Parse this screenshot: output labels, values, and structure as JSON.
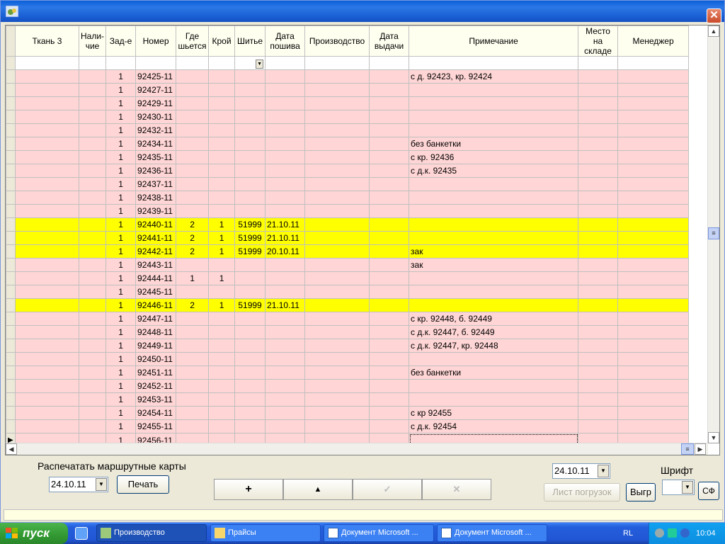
{
  "window": {
    "title": ""
  },
  "grid": {
    "columns": [
      "Ткань 3",
      "Нали-чие",
      "Зад-е",
      "Номер",
      "Где шьется",
      "Крой",
      "Шитье",
      "Дата пошива",
      "Производство",
      "Дата выдачи",
      "Примечание",
      "Место на складе",
      "Менеджер"
    ],
    "rows": [
      {
        "zad": "1",
        "nomer": "92425-11",
        "gde": "",
        "kroy": "",
        "shitye": "",
        "data": "",
        "prim": "с д. 92423, кр. 92424",
        "color": "pink"
      },
      {
        "zad": "1",
        "nomer": "92427-11",
        "gde": "",
        "kroy": "",
        "shitye": "",
        "data": "",
        "prim": "",
        "color": "pink"
      },
      {
        "zad": "1",
        "nomer": "92429-11",
        "gde": "",
        "kroy": "",
        "shitye": "",
        "data": "",
        "prim": "",
        "color": "pink"
      },
      {
        "zad": "1",
        "nomer": "92430-11",
        "gde": "",
        "kroy": "",
        "shitye": "",
        "data": "",
        "prim": "",
        "color": "pink"
      },
      {
        "zad": "1",
        "nomer": "92432-11",
        "gde": "",
        "kroy": "",
        "shitye": "",
        "data": "",
        "prim": "",
        "color": "pink"
      },
      {
        "zad": "1",
        "nomer": "92434-11",
        "gde": "",
        "kroy": "",
        "shitye": "",
        "data": "",
        "prim": "без банкетки",
        "color": "pink"
      },
      {
        "zad": "1",
        "nomer": "92435-11",
        "gde": "",
        "kroy": "",
        "shitye": "",
        "data": "",
        "prim": "с кр. 92436",
        "color": "pink"
      },
      {
        "zad": "1",
        "nomer": "92436-11",
        "gde": "",
        "kroy": "",
        "shitye": "",
        "data": "",
        "prim": "с д.к. 92435",
        "color": "pink"
      },
      {
        "zad": "1",
        "nomer": "92437-11",
        "gde": "",
        "kroy": "",
        "shitye": "",
        "data": "",
        "prim": "",
        "color": "pink"
      },
      {
        "zad": "1",
        "nomer": "92438-11",
        "gde": "",
        "kroy": "",
        "shitye": "",
        "data": "",
        "prim": "",
        "color": "pink"
      },
      {
        "zad": "1",
        "nomer": "92439-11",
        "gde": "",
        "kroy": "",
        "shitye": "",
        "data": "",
        "prim": "",
        "color": "pink"
      },
      {
        "zad": "1",
        "nomer": "92440-11",
        "gde": "2",
        "kroy": "1",
        "shitye": "51999",
        "data": "21.10.11",
        "prim": "",
        "color": "yellow"
      },
      {
        "zad": "1",
        "nomer": "92441-11",
        "gde": "2",
        "kroy": "1",
        "shitye": "51999",
        "data": "21.10.11",
        "prim": "",
        "color": "yellow"
      },
      {
        "zad": "1",
        "nomer": "92442-11",
        "gde": "2",
        "kroy": "1",
        "shitye": "51999",
        "data": "20.10.11",
        "prim": "зак",
        "color": "yellow"
      },
      {
        "zad": "1",
        "nomer": "92443-11",
        "gde": "",
        "kroy": "",
        "shitye": "",
        "data": "",
        "prim": "зак",
        "color": "pink"
      },
      {
        "zad": "1",
        "nomer": "92444-11",
        "gde": "1",
        "kroy": "1",
        "shitye": "",
        "data": "",
        "prim": "",
        "color": "pink"
      },
      {
        "zad": "1",
        "nomer": "92445-11",
        "gde": "",
        "kroy": "",
        "shitye": "",
        "data": "",
        "prim": "",
        "color": "pink"
      },
      {
        "zad": "1",
        "nomer": "92446-11",
        "gde": "2",
        "kroy": "1",
        "shitye": "51999",
        "data": "21.10.11",
        "prim": "",
        "color": "yellow"
      },
      {
        "zad": "1",
        "nomer": "92447-11",
        "gde": "",
        "kroy": "",
        "shitye": "",
        "data": "",
        "prim": "с кр. 92448, б. 92449",
        "color": "pink"
      },
      {
        "zad": "1",
        "nomer": "92448-11",
        "gde": "",
        "kroy": "",
        "shitye": "",
        "data": "",
        "prim": "с д.к. 92447, б. 92449",
        "color": "pink"
      },
      {
        "zad": "1",
        "nomer": "92449-11",
        "gde": "",
        "kroy": "",
        "shitye": "",
        "data": "",
        "prim": "с д.к. 92447, кр. 92448",
        "color": "pink"
      },
      {
        "zad": "1",
        "nomer": "92450-11",
        "gde": "",
        "kroy": "",
        "shitye": "",
        "data": "",
        "prim": "",
        "color": "pink"
      },
      {
        "zad": "1",
        "nomer": "92451-11",
        "gde": "",
        "kroy": "",
        "shitye": "",
        "data": "",
        "prim": "без банкетки",
        "color": "pink"
      },
      {
        "zad": "1",
        "nomer": "92452-11",
        "gde": "",
        "kroy": "",
        "shitye": "",
        "data": "",
        "prim": "",
        "color": "pink"
      },
      {
        "zad": "1",
        "nomer": "92453-11",
        "gde": "",
        "kroy": "",
        "shitye": "",
        "data": "",
        "prim": "",
        "color": "pink"
      },
      {
        "zad": "1",
        "nomer": "92454-11",
        "gde": "",
        "kroy": "",
        "shitye": "",
        "data": "",
        "prim": "с кр 92455",
        "color": "pink"
      },
      {
        "zad": "1",
        "nomer": "92455-11",
        "gde": "",
        "kroy": "",
        "shitye": "",
        "data": "",
        "prim": "с д.к. 92454",
        "color": "pink"
      },
      {
        "zad": "1",
        "nomer": "92456-11",
        "gde": "",
        "kroy": "",
        "shitye": "",
        "data": "",
        "prim": "",
        "color": "pink",
        "current": true
      }
    ]
  },
  "bottom": {
    "print_routes_label": "Распечатать маршрутные карты",
    "print_date": "24.10.11",
    "print_button": "Печать",
    "nav_add": "+",
    "nav_up": "▲",
    "nav_check": "✓",
    "nav_delete": "✕",
    "load_date": "24.10.11",
    "load_sheet_button": "Лист погрузок",
    "export_button": "Выгр",
    "font_label": "Шрифт",
    "font_value": "",
    "sf_button": "СФ"
  },
  "taskbar": {
    "start_label": "пуск",
    "tasks": [
      "Производство",
      "Прайсы",
      "Документ Microsoft ...",
      "Документ Microsoft ..."
    ],
    "lang": "RL",
    "clock": "10:04"
  },
  "colors": {
    "pink": "#ffd5d5",
    "yellow": "#ffff00",
    "header": "#fffff0"
  }
}
